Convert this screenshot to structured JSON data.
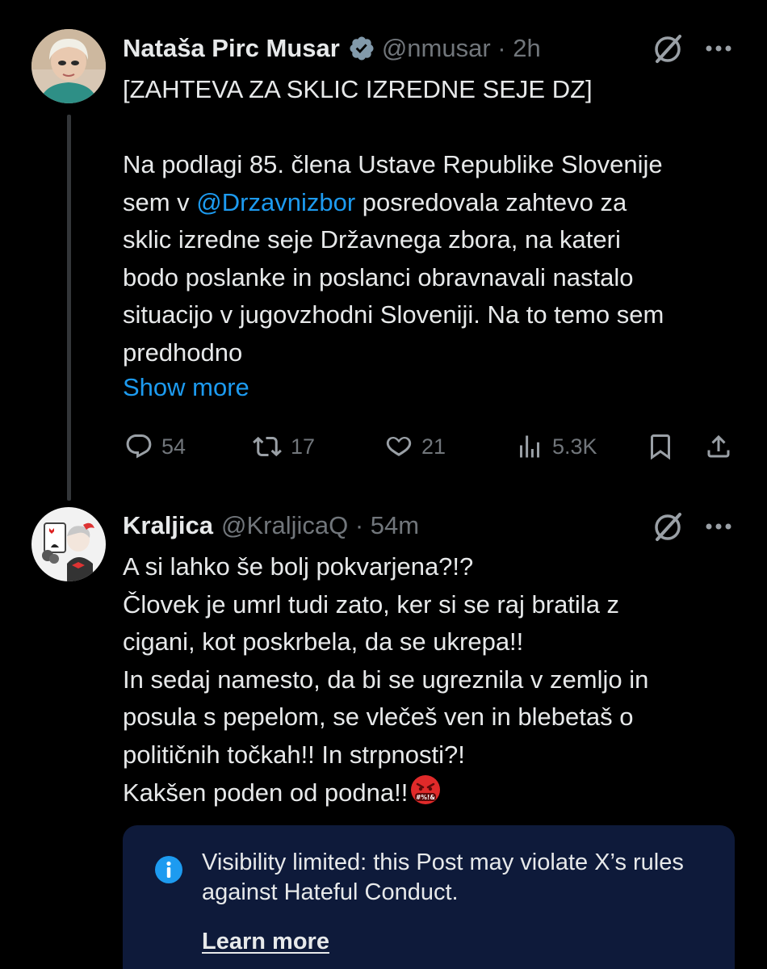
{
  "post1": {
    "author_name": "Nataša Pirc Musar",
    "handle_time": "@nmusar · 2h",
    "text_headline": "[ZAHTEVA ZA SKLIC IZREDNE SEJE DZ]",
    "text_part1": "Na podlagi 85. člena Ustave Republike Slovenije\nsem v ",
    "mention": "@Drzavnizbor",
    "text_part2": " posredovala zahtevo za\nsklic izredne seje Državnega zbora, na kateri\nbodo poslanke in poslanci obravnavali nastalo\nsituacijo v jugovzhodni Sloveniji. Na to temo sem\npredhodno",
    "show_more": "Show more",
    "replies": "54",
    "reposts": "17",
    "likes": "21",
    "views": "5.3K"
  },
  "post2": {
    "author_name": "Kraljica",
    "handle_time": "@KraljicaQ · 54m",
    "text": "A si lahko še bolj pokvarjena?!?\nČlovek je umrl tudi zato, ker si se raj bratila z\ncigani, kot poskrbela, da se ukrepa!!\nIn sedaj namesto, da bi se ugreznila v zemljo in\nposula s pepelom, se vlečeš ven in blebetaš o\npolitičnih točkah!! In strpnosti?!\nKakšen poden od podna!!",
    "notice_text": "Visibility limited: this Post may violate X’s rules against Hateful Conduct.",
    "learn_more": "Learn more"
  },
  "colors": {
    "background": "#000000",
    "text": "#e7e9ea",
    "secondary": "#71767b",
    "accent": "#1d9bf0",
    "notice_bg": "#0e1a3a"
  },
  "icons": [
    "verified-badge-icon",
    "grok-icon",
    "more-icon",
    "reply-icon",
    "repost-icon",
    "like-icon",
    "views-icon",
    "bookmark-icon",
    "share-icon",
    "info-icon",
    "angry-emoji-icon"
  ]
}
